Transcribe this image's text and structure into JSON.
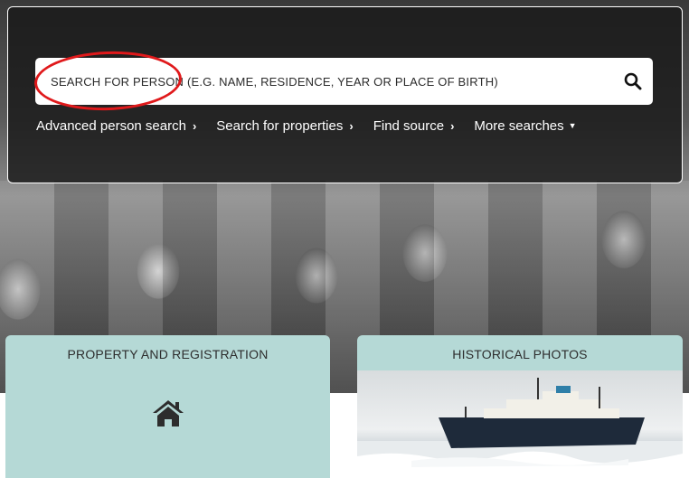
{
  "search": {
    "placeholder": "SEARCH FOR PERSON (E.G. NAME, RESIDENCE, YEAR OR PLACE OF BIRTH)",
    "button_icon": "search-icon"
  },
  "nav": {
    "items": [
      {
        "label": "Advanced person search",
        "icon": "chevron-right-icon"
      },
      {
        "label": "Search for properties",
        "icon": "chevron-right-icon"
      },
      {
        "label": "Find source",
        "icon": "chevron-right-icon"
      },
      {
        "label": "More searches",
        "icon": "caret-down-icon"
      }
    ]
  },
  "cards": {
    "property": {
      "title": "PROPERTY AND REGISTRATION",
      "icon": "home-icon"
    },
    "photos": {
      "title": "HISTORICAL PHOTOS"
    }
  },
  "colors": {
    "panel": "#191919",
    "card": "#b5d9d6",
    "annotation": "#e0191b"
  }
}
